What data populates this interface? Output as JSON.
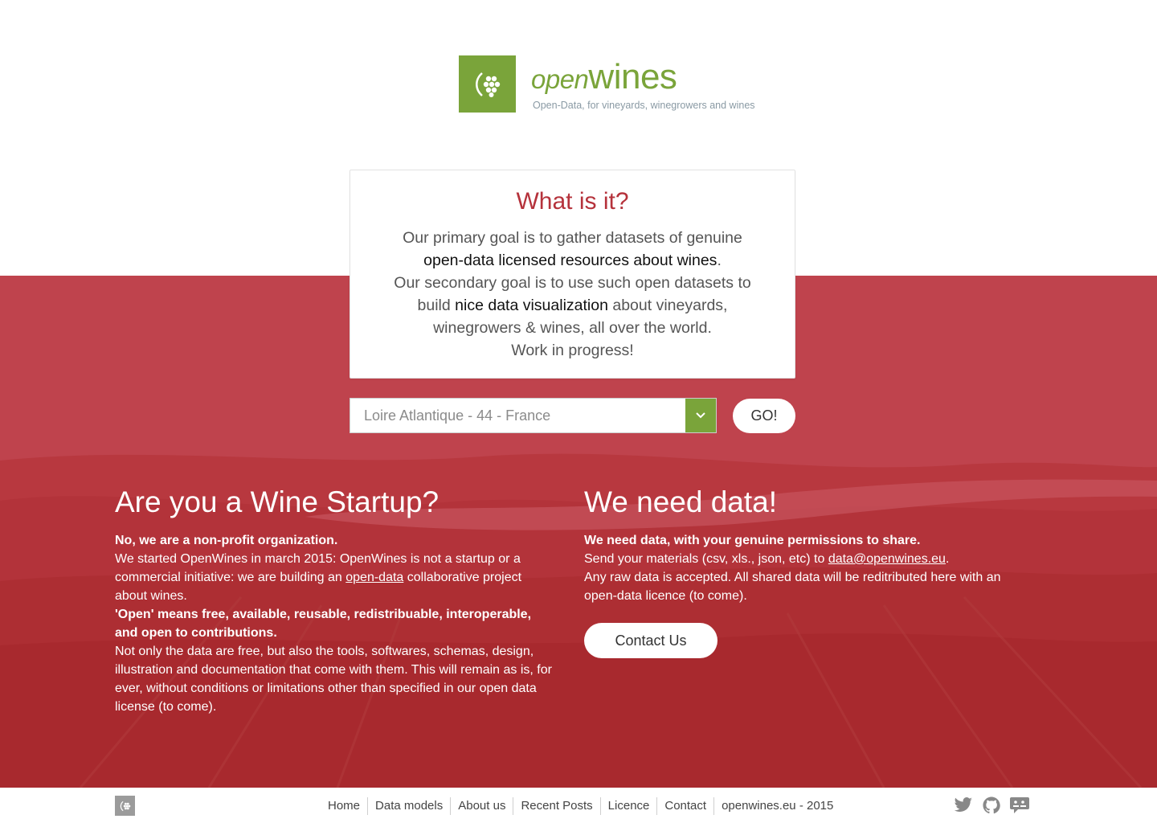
{
  "brand": {
    "name_open": "open",
    "name_wines": "wines",
    "tagline": "Open-Data, for vineyards, winegrowers and wines",
    "green": "#7aa43a",
    "red": "#c0454f"
  },
  "card": {
    "title": "What is it?",
    "line1": "Our primary goal is to gather datasets of genuine",
    "line2_bold": "open-data licensed resources about wines",
    "line2_end": ".",
    "line3": "Our secondary goal is to use such open datasets to",
    "line4_start": "build ",
    "line4_bold": "nice data visualization",
    "line4_end": " about vineyards,",
    "line5": "winegrowers & wines, all over the world.",
    "line6": "Work in progress!"
  },
  "selector": {
    "value": "Loire Atlantique - 44 - France",
    "go_label": "GO!"
  },
  "left": {
    "title": "Are you a Wine Startup?",
    "bold1": "No, we are a non-profit organization.",
    "text1a": "We started OpenWines in march 2015: OpenWines is not a startup or a commercial initiative: we are building an ",
    "text1_link": "open-data",
    "text1b": " collaborative project about wines.",
    "bold2": "'Open' means free, available, reusable, redistribuable, interoperable, and open to contributions.",
    "text2": "Not only the data are free, but also the tools, softwares, schemas, design, illustration and documentation that come with them. This will remain as is, for ever, without conditions or limitations other than specified in our open data license (to come)."
  },
  "right": {
    "title": "We need data!",
    "bold1": "We need data, with your genuine permissions to share.",
    "text1a": "Send your materials (csv, xls., json, etc) to ",
    "email": "data@openwines.eu",
    "text1b": ".",
    "text2": "Any raw data is accepted. All shared data will be reditributed here with an open-data licence (to come).",
    "contact_label": "Contact Us"
  },
  "footer": {
    "nav": [
      "Home",
      "Data models",
      "About us",
      "Recent Posts",
      "Licence",
      "Contact",
      "openwines.eu - 2015"
    ],
    "social": [
      "twitter-icon",
      "github-icon",
      "chat-icon"
    ]
  }
}
